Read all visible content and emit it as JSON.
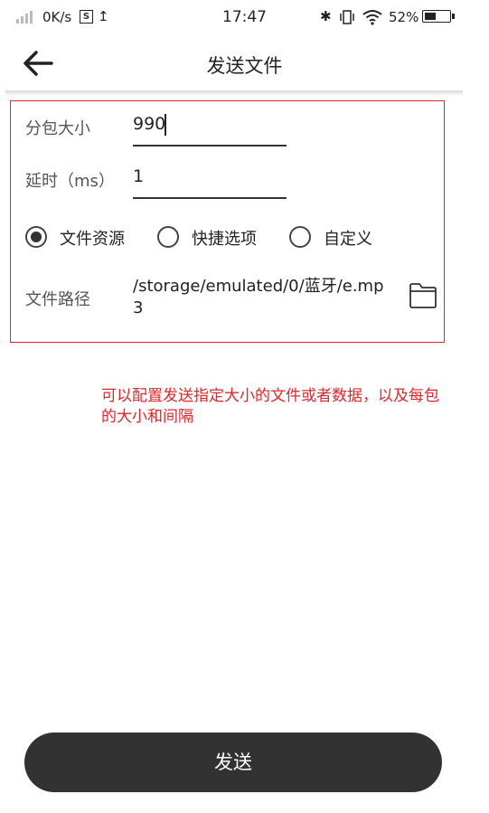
{
  "status_bar": {
    "speed": "0K/s",
    "s_badge": "S",
    "upload_glyph": "↥",
    "time": "17:47",
    "bt_glyph": "✱",
    "battery_percent": "52%",
    "battery_level": 0.52,
    "icons": [
      "signal-icon",
      "s-badge-icon",
      "upload-icon",
      "bluetooth-icon",
      "vibrate-icon",
      "wifi-icon",
      "battery-icon"
    ]
  },
  "header": {
    "title": "发送文件",
    "back_icon": "back-arrow-icon"
  },
  "form": {
    "packet_size": {
      "label": "分包大小",
      "value": "990"
    },
    "delay": {
      "label": "延时（ms）",
      "value": "1"
    },
    "source_options": [
      {
        "label": "文件资源",
        "selected": true
      },
      {
        "label": "快捷选项",
        "selected": false
      },
      {
        "label": "自定义",
        "selected": false
      }
    ],
    "file_path": {
      "label": "文件路径",
      "value": "/storage/emulated/0/蓝牙/e.mp3",
      "browse_icon": "folder-icon"
    }
  },
  "note": "可以配置发送指定大小的文件或者数据，以及每包的大小和间隔",
  "colors": {
    "accent_red": "#e3262b",
    "button_bg": "#323232"
  },
  "send_button": {
    "label": "发送"
  }
}
